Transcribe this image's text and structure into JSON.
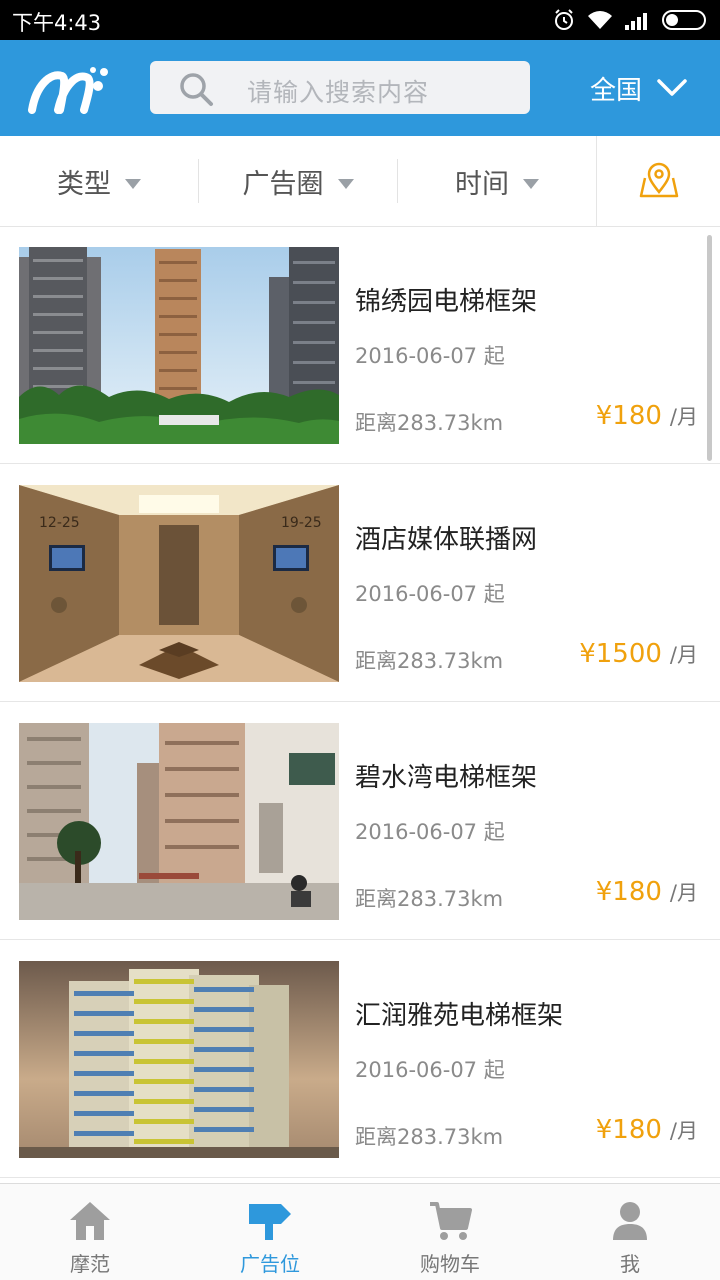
{
  "status_bar": {
    "time": "下午4:43"
  },
  "header": {
    "search_placeholder": "请输入搜索内容",
    "region": "全国",
    "brand_color": "#2e98dc"
  },
  "filters": [
    {
      "label": "类型"
    },
    {
      "label": "广告圈"
    },
    {
      "label": "时间"
    }
  ],
  "listings": [
    {
      "title": "锦绣园电梯框架",
      "date": "2016-06-07 起",
      "distance": "距离283.73km",
      "price": "¥180",
      "unit": "/月",
      "image": "residential-towers-photo"
    },
    {
      "title": "酒店媒体联播网",
      "date": "2016-06-07 起",
      "distance": "距离283.73km",
      "price": "¥1500",
      "unit": "/月",
      "image": "elevator-lobby-photo"
    },
    {
      "title": "碧水湾电梯框架",
      "date": "2016-06-07 起",
      "distance": "距离283.73km",
      "price": "¥180",
      "unit": "/月",
      "image": "apartment-street-photo"
    },
    {
      "title": "汇润雅苑电梯框架",
      "date": "2016-06-07 起",
      "distance": "距离283.73km",
      "price": "¥180",
      "unit": "/月",
      "image": "highrise-building-photo"
    }
  ],
  "bottom_nav": [
    {
      "label": "摩范",
      "icon": "home-icon",
      "active": false
    },
    {
      "label": "广告位",
      "icon": "ad-sign-icon",
      "active": true
    },
    {
      "label": "购物车",
      "icon": "cart-icon",
      "active": false
    },
    {
      "label": "我",
      "icon": "user-icon",
      "active": false
    }
  ],
  "colors": {
    "price": "#f0a10d",
    "accent": "#2e98dc",
    "map_icon": "#f0a10d"
  }
}
